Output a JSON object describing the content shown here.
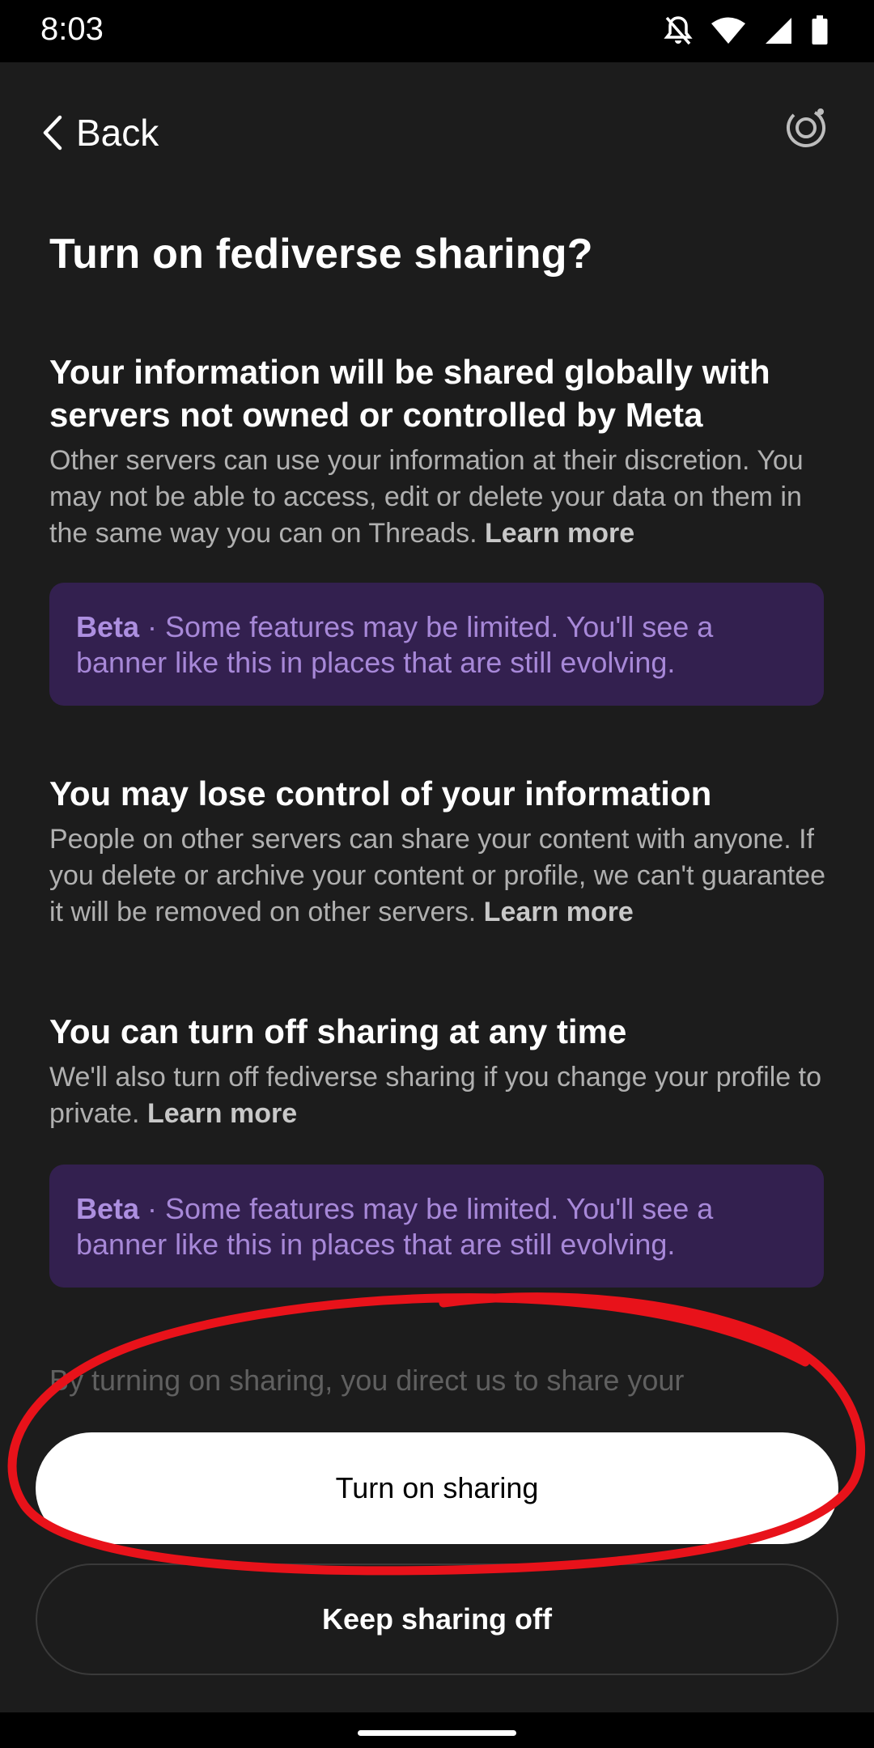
{
  "status_bar": {
    "time": "8:03"
  },
  "header": {
    "back_label": "Back"
  },
  "page_title": "Turn on fediverse sharing?",
  "sections": [
    {
      "heading": "Your information will be shared globally with servers not owned or controlled by Meta",
      "body": "Other servers can use your information at their discretion. You may not be able to access, edit or delete your data on them in the same way you can on Threads.",
      "learn_more": "Learn more"
    },
    {
      "heading": "You may lose control of your information",
      "body": "People on other servers can share your content with anyone. If you delete or archive your content or profile, we can't guarantee it will be removed on other servers.",
      "learn_more": "Learn more"
    },
    {
      "heading": "You can turn off sharing at any time",
      "body": "We'll also turn off fediverse sharing if you change your profile to private.",
      "learn_more": "Learn more"
    }
  ],
  "beta_banner": {
    "label": "Beta",
    "separator": " · ",
    "text": "Some features may be limited. You'll see a banner like this in places that are still evolving."
  },
  "faded_disclaimer": "By turning on sharing, you direct us to share your",
  "buttons": {
    "primary": "Turn on sharing",
    "secondary": "Keep sharing off"
  },
  "colors": {
    "background": "#1c1c1c",
    "banner_background": "#33204f",
    "banner_text": "#a788d8",
    "annotation": "#e8121a"
  }
}
